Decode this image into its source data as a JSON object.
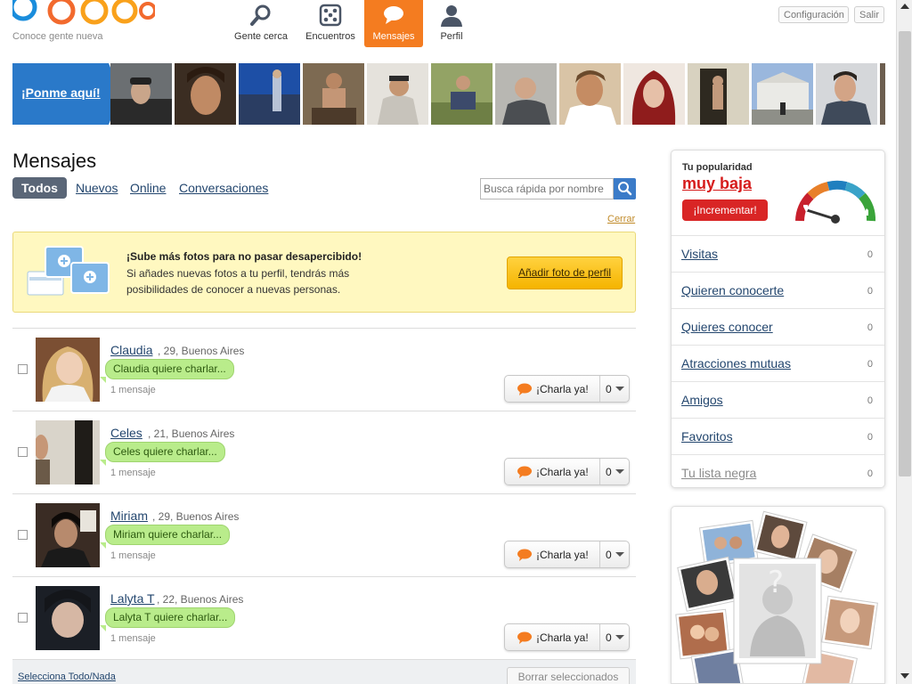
{
  "header": {
    "tagline": "Conoce gente nueva",
    "nav": [
      {
        "label": "Gente cerca",
        "icon": "magnifier-icon"
      },
      {
        "label": "Encuentros",
        "icon": "dice-icon"
      },
      {
        "label": "Mensajes",
        "icon": "speech-bubble-icon",
        "active": true
      },
      {
        "label": "Perfil",
        "icon": "person-icon"
      }
    ],
    "config_label": "Configuración",
    "logout_label": "Salir"
  },
  "strip": {
    "cta_label": "¡Ponme aquí!"
  },
  "main": {
    "title": "Mensajes",
    "tabs": [
      {
        "label": "Todos",
        "active": true
      },
      {
        "label": "Nuevos"
      },
      {
        "label": "Online"
      },
      {
        "label": "Conversaciones"
      }
    ],
    "search_placeholder": "Busca rápida por nombre",
    "close_label": "Cerrar"
  },
  "promo": {
    "title": "¡Sube más fotos para no pasar desapercibido!",
    "text": "Si añades nuevas fotos a tu perfil, tendrás más posibilidades de conocer a nuevas personas.",
    "button_label": "Añadir foto de perfil"
  },
  "messages": [
    {
      "name": "Claudia",
      "meta": ", 29, Buenos Aires",
      "bubble": "Claudia quiere charlar...",
      "count_label": "1 mensaje",
      "chat_label": "¡Charla ya!",
      "chat_count": "0"
    },
    {
      "name": "Celes",
      "meta": ", 21, Buenos Aires",
      "bubble": "Celes quiere charlar...",
      "count_label": "1 mensaje",
      "chat_label": "¡Charla ya!",
      "chat_count": "0"
    },
    {
      "name": "Miriam",
      "meta": ", 29, Buenos Aires",
      "bubble": "Miriam quiere charlar...",
      "count_label": "1 mensaje",
      "chat_label": "¡Charla ya!",
      "chat_count": "0"
    },
    {
      "name": "Lalyta T",
      "meta": ", 22, Buenos Aires",
      "bubble": "Lalyta T quiere charlar...",
      "count_label": "1 mensaje",
      "chat_label": "¡Charla ya!",
      "chat_count": "0"
    }
  ],
  "footer": {
    "select_all": "Selecciona Todo/Nada",
    "delete_label": "Borrar seleccionados"
  },
  "sidebar": {
    "popularity_label": "Tu popularidad",
    "popularity_value": "muy baja",
    "increase_label": "¡Incrementar!",
    "items": [
      {
        "label": "Visitas",
        "count": "0"
      },
      {
        "label": "Quieren conocerte",
        "count": "0"
      },
      {
        "label": "Quieres conocer",
        "count": "0"
      },
      {
        "label": "Atracciones mutuas",
        "count": "0"
      },
      {
        "label": "Amigos",
        "count": "0"
      },
      {
        "label": "Favoritos",
        "count": "0"
      },
      {
        "label": "Tu lista negra",
        "count": "0"
      }
    ]
  },
  "colors": {
    "accent_orange": "#f47c20",
    "link_blue": "#23466e",
    "bubble_green": "#b9ec8b",
    "alert_red": "#d61b1b"
  }
}
